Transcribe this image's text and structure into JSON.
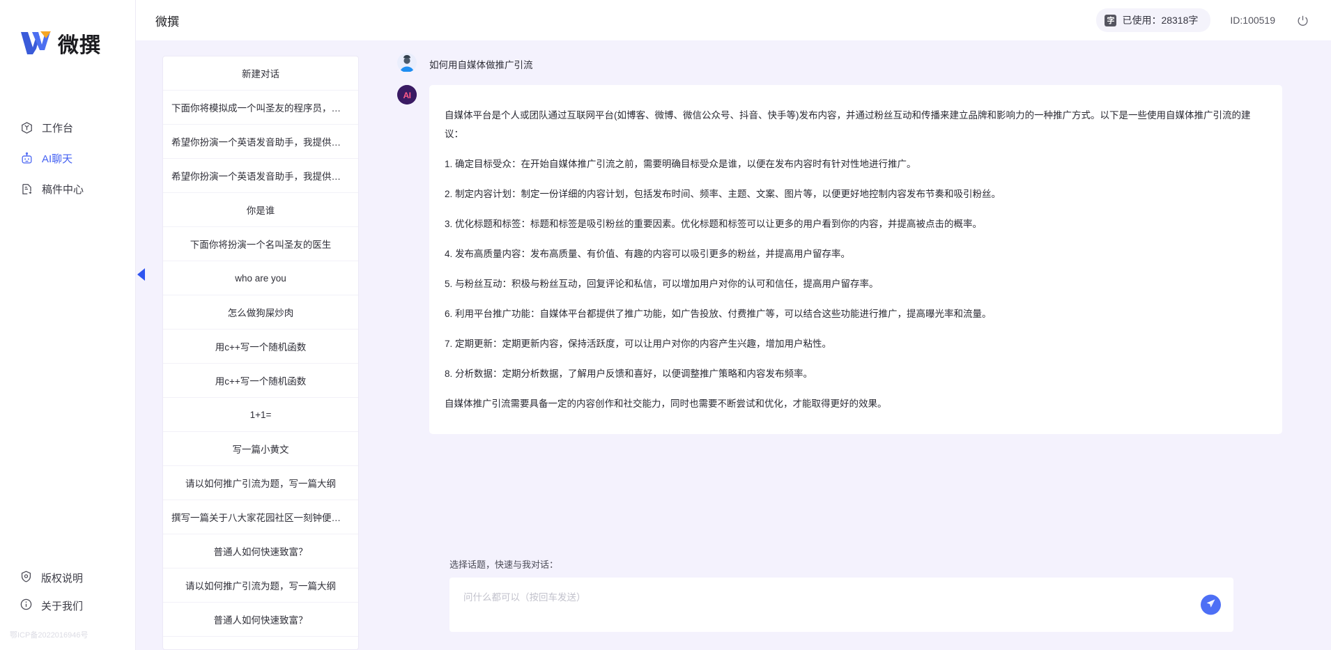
{
  "brand": {
    "logo_text": "微撰",
    "logo_icon": "w-logo-icon"
  },
  "sidebar": {
    "items": [
      {
        "label": "工作台",
        "icon": "workbench-icon",
        "active": false
      },
      {
        "label": "AI聊天",
        "icon": "robot-icon",
        "active": true
      },
      {
        "label": "稿件中心",
        "icon": "document-icon",
        "active": false
      }
    ],
    "footer_items": [
      {
        "label": "版权说明",
        "icon": "shield-icon"
      },
      {
        "label": "关于我们",
        "icon": "info-icon"
      }
    ],
    "icp": "鄂ICP备2022016946号"
  },
  "topbar": {
    "title": "微撰",
    "usage_badge": "字",
    "usage_label": "已使用：28318字",
    "user_id": "ID:100519",
    "power_icon": "power-icon"
  },
  "conversations": {
    "new_chat_label": "新建对话",
    "collapse_icon": "chevron-left-icon",
    "items": [
      "下面你将模拟成一个叫圣友的程序员，我说...",
      "希望你扮演一个英语发音助手，我提供给你...",
      "希望你扮演一个英语发音助手，我提供给你...",
      "你是谁",
      "下面你将扮演一个名叫圣友的医生",
      "who are you",
      "怎么做狗屎炒肉",
      "用c++写一个随机函数",
      "用c++写一个随机函数",
      "1+1=",
      "写一篇小黄文",
      "请以如何推广引流为题，写一篇大纲",
      "撰写一篇关于八大家花园社区一刻钟便民生...",
      "普通人如何快速致富？",
      "请以如何推广引流为题，写一篇大纲",
      "普通人如何快速致富？"
    ]
  },
  "chat": {
    "user": {
      "avatar_icon": "user-avatar-icon",
      "message": "如何用自媒体做推广引流"
    },
    "assistant": {
      "avatar_icon": "ai-avatar-icon",
      "avatar_text": "AI",
      "paragraphs": [
        "自媒体平台是个人或团队通过互联网平台(如博客、微博、微信公众号、抖音、快手等)发布内容，并通过粉丝互动和传播来建立品牌和影响力的一种推广方式。以下是一些使用自媒体推广引流的建议：",
        "1. 确定目标受众：在开始自媒体推广引流之前，需要明确目标受众是谁，以便在发布内容时有针对性地进行推广。",
        "2. 制定内容计划：制定一份详细的内容计划，包括发布时间、频率、主题、文案、图片等，以便更好地控制内容发布节奏和吸引粉丝。",
        "3. 优化标题和标签：标题和标签是吸引粉丝的重要因素。优化标题和标签可以让更多的用户看到你的内容，并提高被点击的概率。",
        "4. 发布高质量内容：发布高质量、有价值、有趣的内容可以吸引更多的粉丝，并提高用户留存率。",
        "5. 与粉丝互动：积极与粉丝互动，回复评论和私信，可以增加用户对你的认可和信任，提高用户留存率。",
        "6. 利用平台推广功能：自媒体平台都提供了推广功能，如广告投放、付费推广等，可以结合这些功能进行推广，提高曝光率和流量。",
        "7. 定期更新：定期更新内容，保持活跃度，可以让用户对你的内容产生兴趣，增加用户粘性。",
        "8. 分析数据：定期分析数据，了解用户反馈和喜好，以便调整推广策略和内容发布频率。",
        "自媒体推广引流需要具备一定的内容创作和社交能力，同时也需要不断尝试和优化，才能取得更好的效果。"
      ]
    }
  },
  "composer": {
    "topic_hint": "选择话题，快速与我对话：",
    "placeholder": "问什么都可以（按回车发送）",
    "send_icon": "send-icon"
  },
  "colors": {
    "accent": "#4461f2",
    "send_button": "#4d6ff5",
    "page_bg": "#f4f2fd",
    "panel_bg": "#ffffff"
  }
}
